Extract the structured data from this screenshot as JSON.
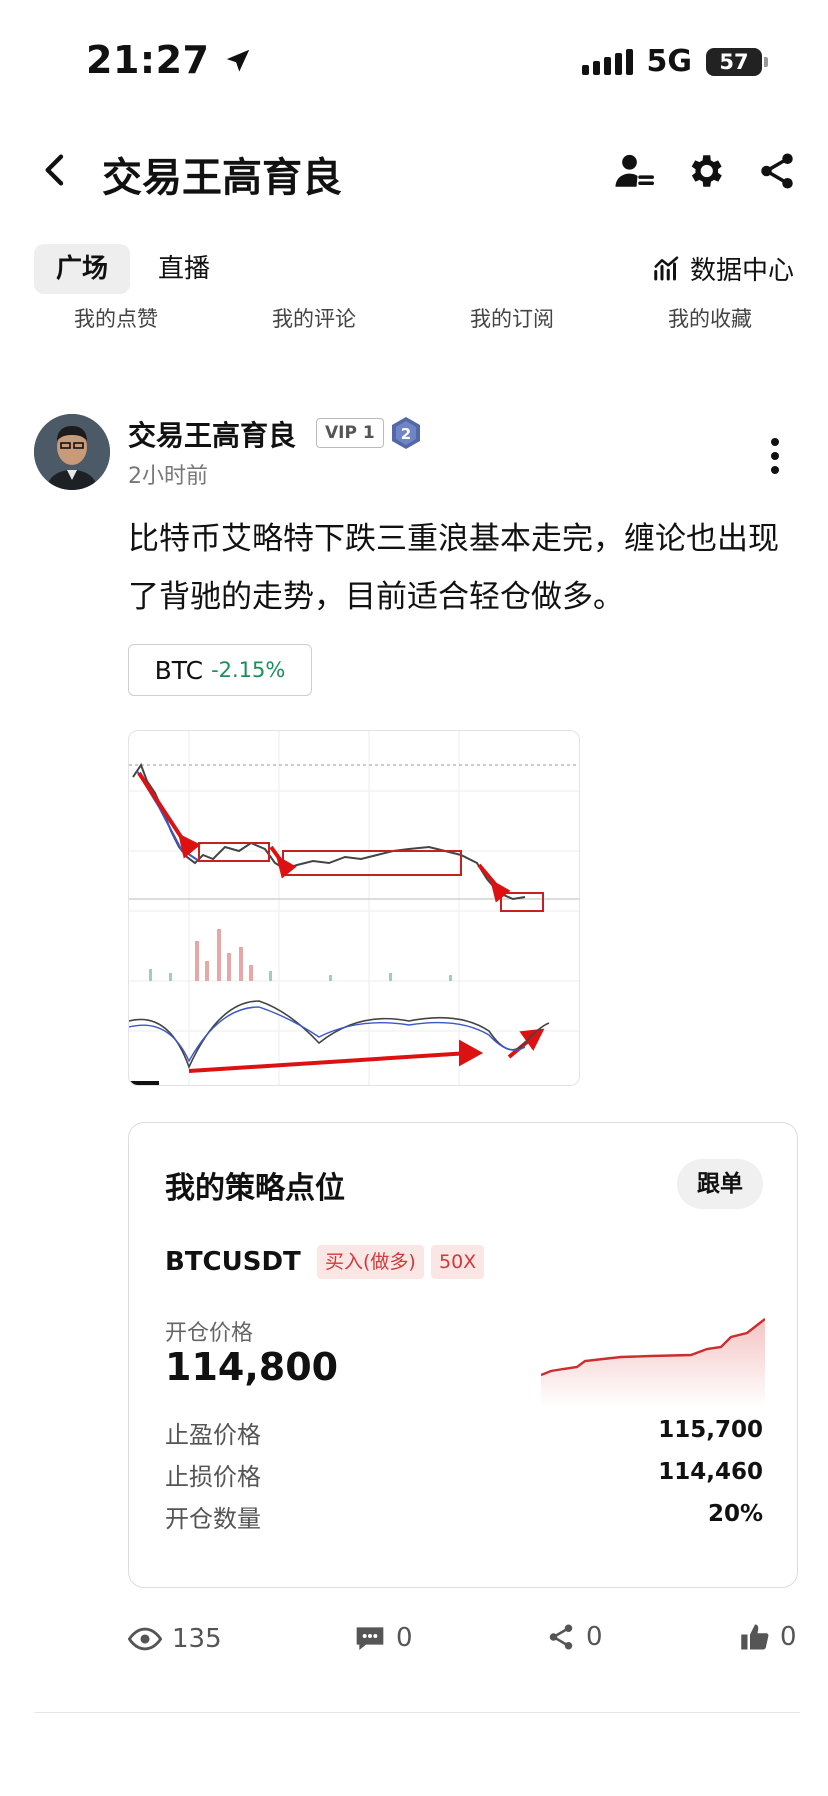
{
  "status_bar": {
    "time": "21:27",
    "network": "5G",
    "battery": "57"
  },
  "header": {
    "title": "交易王高育良",
    "icons": [
      "back-icon",
      "user-follow-icon",
      "gear-icon",
      "share-icon"
    ]
  },
  "tabs": [
    {
      "label": "广场",
      "active": true
    },
    {
      "label": "直播",
      "active": false
    }
  ],
  "data_center": {
    "label": "数据中心",
    "icon": "chart-icon"
  },
  "subnav": [
    "我的点赞",
    "我的评论",
    "我的订阅",
    "我的收藏"
  ],
  "post": {
    "author": "交易王高育良",
    "vip": "VIP 1",
    "level": "2",
    "time": "2小时前",
    "content": "比特币艾略特下跌三重浪基本走完，缠论也出现了背驰的走势，目前适合轻仓做多。",
    "ticker": {
      "symbol": "BTC",
      "change": "-2.15%"
    }
  },
  "strategy": {
    "title": "我的策略点位",
    "follow_label": "跟单",
    "pair": "BTCUSDT",
    "side": "买入(做多)",
    "leverage": "50X",
    "open_price_label": "开仓价格",
    "open_price": "114,800",
    "rows": [
      {
        "label": "止盈价格",
        "value": "115,700"
      },
      {
        "label": "止损价格",
        "value": "114,460"
      },
      {
        "label": "开仓数量",
        "value": "20%"
      }
    ],
    "accent": "#d23a3a"
  },
  "stats": {
    "views": "135",
    "comments": "0",
    "shares": "0",
    "likes": "0"
  }
}
